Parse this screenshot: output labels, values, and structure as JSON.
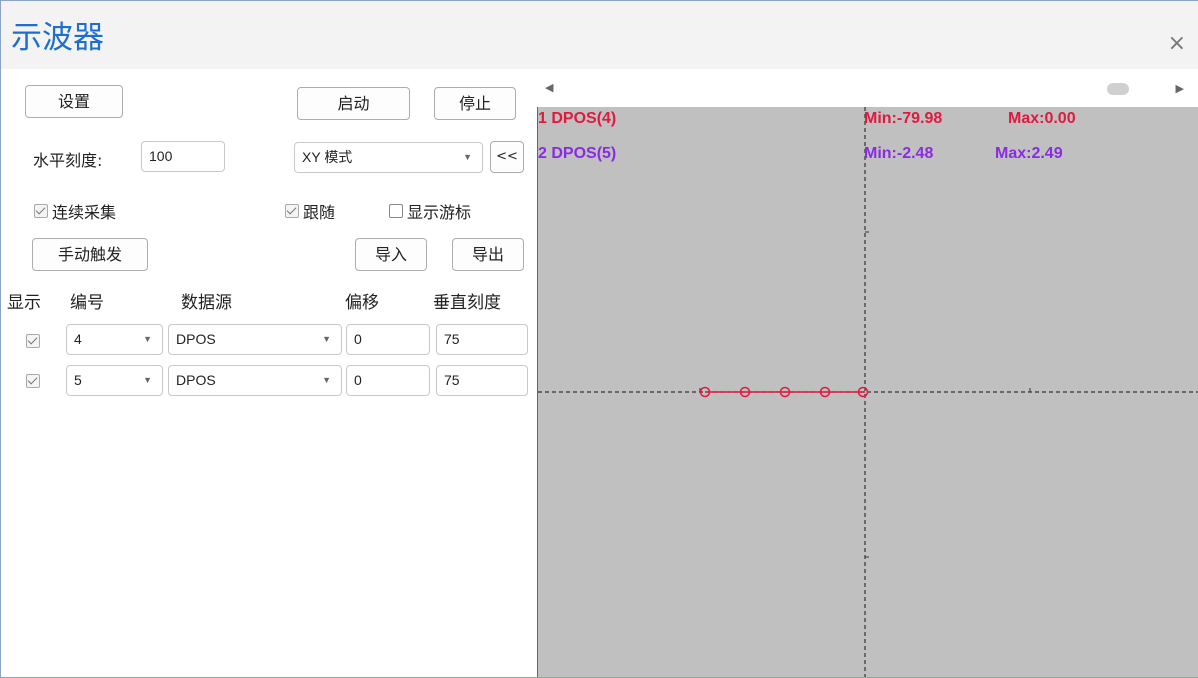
{
  "window": {
    "title": "示波器",
    "close_icon": "×"
  },
  "toolbar": {
    "settings": "设置",
    "start": "启动",
    "stop": "停止",
    "collapse": "<<",
    "manual_trigger": "手动触发",
    "import": "导入",
    "export": "导出"
  },
  "horizontal": {
    "label": "水平刻度:",
    "value": "100"
  },
  "mode": {
    "value": "XY 模式"
  },
  "options": {
    "continuous": {
      "label": "连续采集",
      "checked": true
    },
    "follow": {
      "label": "跟随",
      "checked": true
    },
    "show_cursor": {
      "label": "显示游标",
      "checked": false
    }
  },
  "table": {
    "headers": {
      "show": "显示",
      "number": "编号",
      "source": "数据源",
      "offset": "偏移",
      "vscale": "垂直刻度"
    },
    "rows": [
      {
        "show": true,
        "number": "4",
        "source": "DPOS",
        "offset": "0",
        "vscale": "75"
      },
      {
        "show": true,
        "number": "5",
        "source": "DPOS",
        "offset": "0",
        "vscale": "75"
      }
    ]
  },
  "channels": [
    {
      "label": "1 DPOS(4)",
      "min": "Min:-79.98",
      "max": "Max:0.00",
      "color": "#e0193f"
    },
    {
      "label": "2 DPOS(5)",
      "min": "Min:-2.48",
      "max": "Max:2.49",
      "color": "#8a2be2"
    }
  ],
  "colors": {
    "accent": "#1c6ed1",
    "plot_bg": "#c0c0c0",
    "trace": "#e0193f"
  },
  "chart_data": {
    "type": "scatter",
    "mode": "XY",
    "series": [
      {
        "name": "1 DPOS(4)",
        "values": [
          -79.98,
          -60,
          -40,
          -20,
          0
        ]
      },
      {
        "name": "2 DPOS(5)",
        "values": [
          0,
          0,
          0,
          0,
          0
        ]
      }
    ],
    "x": [
      -79.98,
      -60,
      -40,
      -20,
      0
    ],
    "y": [
      0,
      0,
      0,
      0,
      0
    ],
    "markers_x": [
      -79.98,
      -60,
      -40,
      -20,
      -1
    ],
    "grid": true
  }
}
